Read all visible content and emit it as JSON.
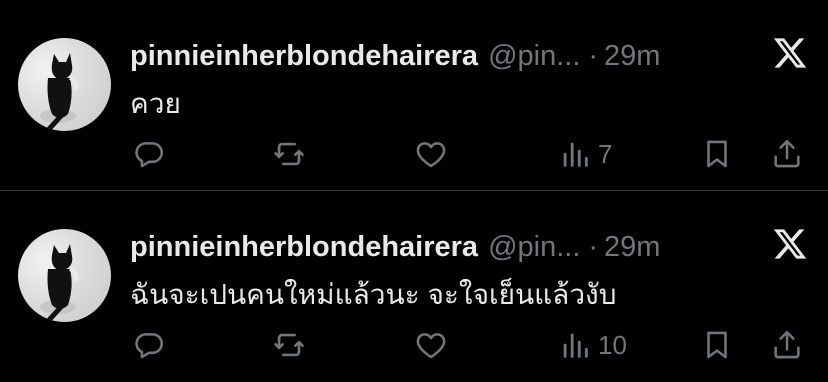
{
  "tweets": [
    {
      "display_name": "pinnieinherblondehairera",
      "handle": "@pin...",
      "separator": "·",
      "time": "29m",
      "text": "ควย",
      "views": "7",
      "avatar_icon": "black-cat-avatar",
      "source_icon": "x-logo-icon"
    },
    {
      "display_name": "pinnieinherblondehairera",
      "handle": "@pin...",
      "separator": "·",
      "time": "29m",
      "text": "ฉันจะเปนคนใหม่แล้วนะ จะใจเย็นแล้วงับ",
      "views": "10",
      "avatar_icon": "black-cat-avatar",
      "source_icon": "x-logo-icon"
    }
  ],
  "colors": {
    "background": "#000000",
    "primary_text": "#e7e9ea",
    "secondary_text": "#71767b",
    "divider": "#2f3336"
  }
}
